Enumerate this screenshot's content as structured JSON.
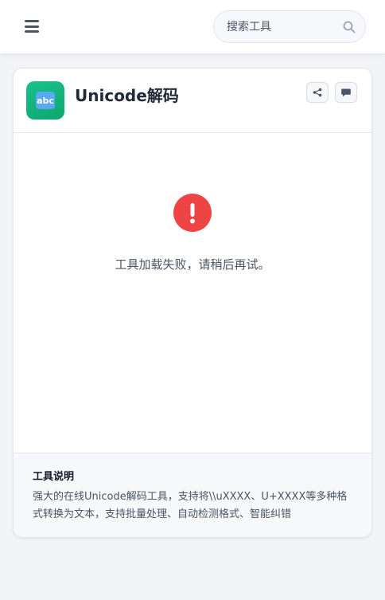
{
  "header": {
    "search": {
      "placeholder": "搜索工具",
      "value": ""
    }
  },
  "tool": {
    "icon_text": "abc",
    "title": "Unicode解码",
    "error_message": "工具加载失败，请稍后再试。",
    "description_title": "工具说明",
    "description_text": "强大的在线Unicode解码工具，支持将\\\\uXXXX、U+XXXX等多种格式转换为文本，支持批量处理、自动检测格式、智能纠错"
  },
  "colors": {
    "accent_green": "#10b981",
    "error_red": "#ef4444"
  },
  "icons": [
    "menu-icon",
    "search-icon",
    "share-icon",
    "comment-icon",
    "exclamation-icon"
  ]
}
